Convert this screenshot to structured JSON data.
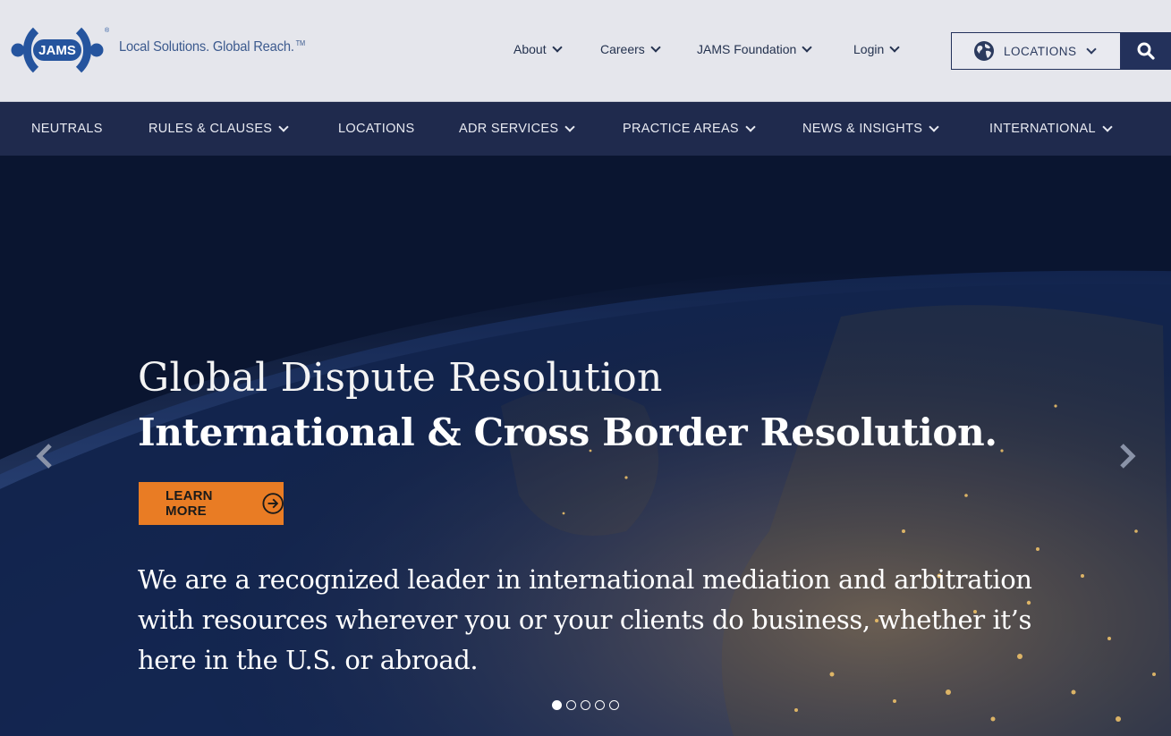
{
  "brand": {
    "logo_text": "JAMS",
    "tagline": "Local Solutions. Global Reach.",
    "tagline_mark": "TM"
  },
  "util_nav": [
    {
      "label": "About"
    },
    {
      "label": "Careers"
    },
    {
      "label": "JAMS Foundation"
    },
    {
      "label": "Login"
    }
  ],
  "locations": {
    "label": "LOCATIONS"
  },
  "main_nav": [
    {
      "label": "NEUTRALS",
      "dropdown": false
    },
    {
      "label": "RULES & CLAUSES",
      "dropdown": true
    },
    {
      "label": "LOCATIONS",
      "dropdown": false
    },
    {
      "label": "ADR SERVICES",
      "dropdown": true
    },
    {
      "label": "PRACTICE AREAS",
      "dropdown": true
    },
    {
      "label": "NEWS & INSIGHTS",
      "dropdown": true
    },
    {
      "label": "INTERNATIONAL",
      "dropdown": true
    }
  ],
  "hero": {
    "title": "Global Dispute Resolution",
    "subtitle": "International & Cross Border Resolution.",
    "cta_label": "LEARN MORE",
    "description": "We are a recognized leader in international mediation and arbitration with resources wherever you or your clients do business, whether it’s here in the U.S. or abroad.",
    "slide_count": 5,
    "active_slide": 1
  },
  "colors": {
    "nav_bg": "#1f2a4d",
    "header_bg": "#e5e6ec",
    "accent": "#e97c24",
    "brand_blue": "#3c5a8e"
  },
  "icons": {
    "logo": "jams-logo",
    "globe": "globe-icon",
    "search": "search-icon",
    "prev": "chevron-left-icon",
    "next": "chevron-right-icon",
    "cta": "arrow-circle-right-icon"
  }
}
